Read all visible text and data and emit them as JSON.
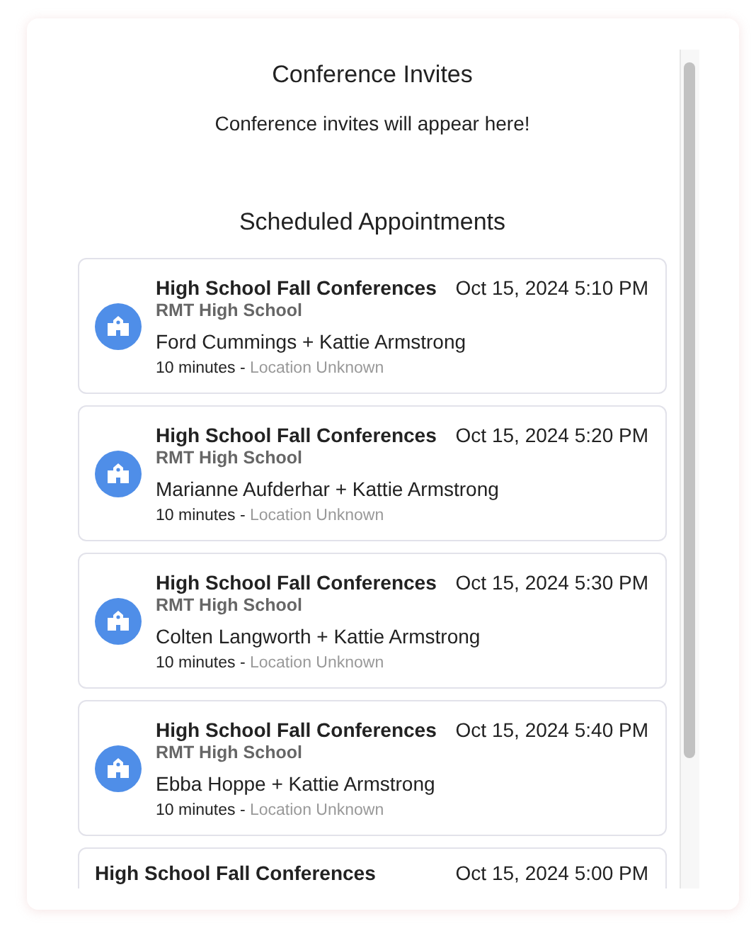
{
  "invites": {
    "title": "Conference Invites",
    "empty_message": "Conference invites will appear here!"
  },
  "appointments": {
    "title": "Scheduled Appointments",
    "items": [
      {
        "title": "High School Fall Conferences",
        "datetime": "Oct 15, 2024 5:10 PM",
        "school": "RMT High School",
        "participants": "Ford Cummings + Kattie Armstrong",
        "duration": "10 minutes",
        "separator": "-",
        "location": "Location Unknown"
      },
      {
        "title": "High School Fall Conferences",
        "datetime": "Oct 15, 2024 5:20 PM",
        "school": "RMT High School",
        "participants": "Marianne Aufderhar + Kattie Armstrong",
        "duration": "10 minutes",
        "separator": "-",
        "location": "Location Unknown"
      },
      {
        "title": "High School Fall Conferences",
        "datetime": "Oct 15, 2024 5:30 PM",
        "school": "RMT High School",
        "participants": "Colten Langworth + Kattie Armstrong",
        "duration": "10 minutes",
        "separator": "-",
        "location": "Location Unknown"
      },
      {
        "title": "High School Fall Conferences",
        "datetime": "Oct 15, 2024 5:40 PM",
        "school": "RMT High School",
        "participants": "Ebba Hoppe + Kattie Armstrong",
        "duration": "10 minutes",
        "separator": "-",
        "location": "Location Unknown"
      },
      {
        "title": "High School Fall Conferences",
        "datetime": "Oct 15, 2024 5:00 PM"
      }
    ]
  }
}
